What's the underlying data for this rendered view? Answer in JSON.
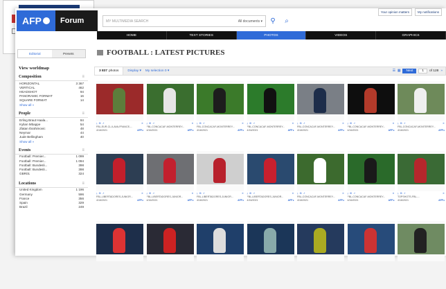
{
  "header": {
    "logo_afp": "AFP",
    "logo_forum": "Forum",
    "search_placeholder": "MY MULTIMEDIA SEARCH",
    "search_scope": "All documents",
    "search_icon": "search-icon",
    "advanced_icon": "advanced-search-icon",
    "links": [
      "Your opinion matters",
      "My notifications"
    ]
  },
  "nav": {
    "items": [
      "HOME",
      "TEXT STORIES",
      "PHOTOS",
      "VIDEOS",
      "GRAPHICS"
    ],
    "active": "PHOTOS"
  },
  "sidebar": {
    "tabs": [
      "Editorial",
      "Presets"
    ],
    "selected_tab": "Presets",
    "title": "View worldmap",
    "sections": [
      {
        "name": "Composition",
        "items": [
          [
            "HORIZONTAL",
            "3 367"
          ],
          [
            "VERTICAL",
            "462"
          ],
          [
            "HEADSHOT",
            "94"
          ],
          [
            "PANORAMIC FORMAT",
            "16"
          ],
          [
            "SQUARE FORMAT",
            "14"
          ]
        ],
        "more": "Show all »"
      },
      {
        "name": "People",
        "items": [
          [
            "Erling Braut Haala...",
            "84"
          ],
          [
            "Kylian Mbappe",
            "54"
          ],
          [
            "Zlatan Ibrahimovic",
            "48"
          ],
          [
            "Neymar",
            "44"
          ],
          [
            "Jude Bellingham",
            "40"
          ]
        ],
        "more": "Show all »"
      },
      {
        "name": "Events",
        "items": [
          [
            "Football: Premier...",
            "1 099"
          ],
          [
            "Football: Premier...",
            "1 094"
          ],
          [
            "Football: Bundesli...",
            "398"
          ],
          [
            "Football: Bundesli...",
            "398"
          ],
          [
            "GBR01",
            "324"
          ]
        ],
        "more": ""
      },
      {
        "name": "Locations",
        "items": [
          [
            "United Kingdom",
            "1 196"
          ],
          [
            "Germany",
            "596"
          ],
          [
            "France",
            "356"
          ],
          [
            "Spain",
            "329"
          ],
          [
            "Brazil",
            "249"
          ]
        ],
        "more": ""
      }
    ]
  },
  "main": {
    "title": "FOOTBALL : LATEST PICTURES",
    "count": "3 837",
    "count_label": "photos",
    "display_label": "Display",
    "selection_label": "My selection 0",
    "next_label": "Next",
    "page_current": "1",
    "page_total": "of 128"
  },
  "cards": [
    {
      "cap": "FBL-EUR-CL-ILAVA-FRANCE-...",
      "date": "4/16/2021",
      "icons": [
        "download-icon",
        "cart-icon",
        "share-icon"
      ]
    },
    {
      "cap": "FBL-CONCACAF-MONTERREY...",
      "date": "4/16/2021",
      "icons": [
        "download-icon",
        "cart-icon",
        "share-icon"
      ]
    },
    {
      "cap": "FBL-CONCACAF-MONTERREY...",
      "date": "4/16/2021",
      "icons": [
        "download-icon",
        "cart-icon",
        "share-icon"
      ]
    },
    {
      "cap": "FBL-CONCACAF-MONTERREY...",
      "date": "4/16/2021",
      "icons": [
        "download-icon",
        "cart-icon",
        "share-icon"
      ]
    },
    {
      "cap": "FBL-CONCACAF-MONTERREY...",
      "date": "4/16/2021",
      "icons": [
        "download-icon",
        "cart-icon",
        "share-icon"
      ]
    },
    {
      "cap": "FBL-CONCACAF-MONTERREY...",
      "date": "4/16/2021",
      "icons": [
        "download-icon",
        "cart-icon",
        "share-icon"
      ]
    },
    {
      "cap": "FBL-CONCACAF-MONTERREY...",
      "date": "4/16/2021",
      "icons": [
        "download-icon",
        "cart-icon",
        "share-icon"
      ]
    },
    {
      "cap": "FBL-LIBERTADORES-JUNIOR...",
      "date": "4/16/2021",
      "icons": [
        "download-icon",
        "cart-icon",
        "share-icon"
      ]
    },
    {
      "cap": "FBL-LIBERTADORES-JUNIOR...",
      "date": "4/16/2021",
      "icons": [
        "download-icon",
        "cart-icon",
        "share-icon"
      ]
    },
    {
      "cap": "FBL-LIBERTADORES-JUNIOR...",
      "date": "4/16/2021",
      "icons": [
        "download-icon",
        "cart-icon",
        "share-icon"
      ]
    },
    {
      "cap": "FBL-LIBERTADORES-JUNIOR...",
      "date": "4/16/2021",
      "icons": [
        "download-icon",
        "cart-icon",
        "share-icon"
      ]
    },
    {
      "cap": "FBL-CONCACAF-MONTERREY...",
      "date": "4/16/2021",
      "icons": [
        "download-icon",
        "cart-icon",
        "share-icon"
      ]
    },
    {
      "cap": "FBL-CONCACAF-MONTERREY...",
      "date": "4/16/2021",
      "icons": [
        "download-icon",
        "cart-icon",
        "share-icon"
      ]
    },
    {
      "cap": "TOPSHOTS-FBL-...",
      "date": "4/16/2021",
      "icons": [
        "download-icon",
        "cart-icon",
        "share-icon"
      ]
    },
    {
      "cap": "",
      "date": "",
      "icons": []
    },
    {
      "cap": "",
      "date": "",
      "icons": []
    },
    {
      "cap": "",
      "date": "",
      "icons": []
    },
    {
      "cap": "",
      "date": "",
      "icons": []
    },
    {
      "cap": "",
      "date": "",
      "icons": []
    },
    {
      "cap": "",
      "date": "",
      "icons": []
    },
    {
      "cap": "",
      "date": "",
      "icons": []
    }
  ],
  "brand_color": "#2f6bd8",
  "nav_color": "#111111"
}
